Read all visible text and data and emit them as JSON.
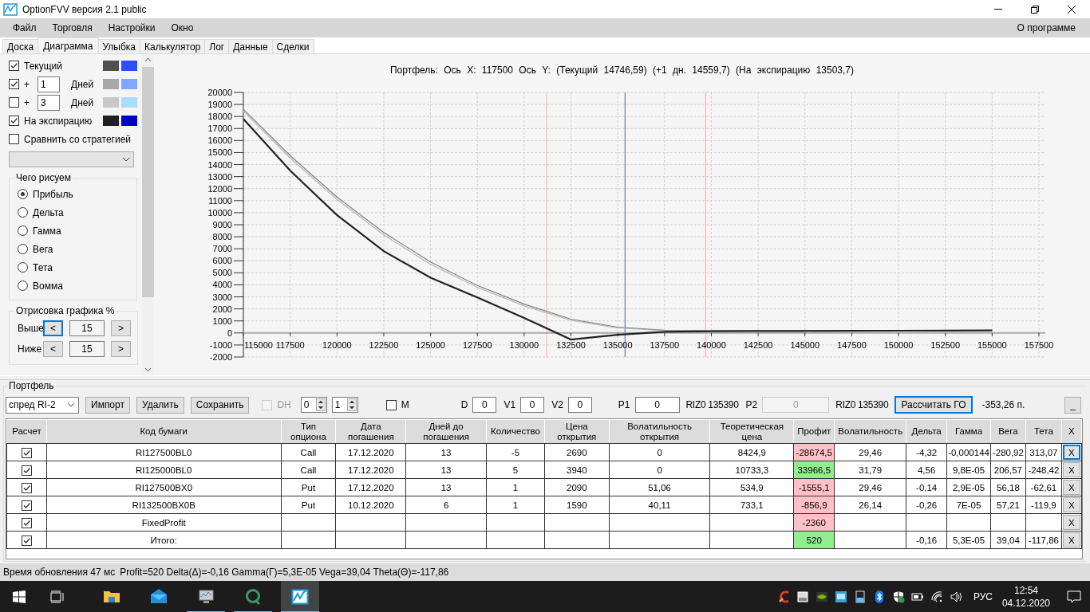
{
  "window": {
    "title": "OptionFVV версия 2.1 public"
  },
  "menu": {
    "items": [
      "Файл",
      "Торговля",
      "Настройки",
      "Окно"
    ],
    "right": "О программе"
  },
  "tabs": [
    {
      "label": "Доска",
      "selected": false
    },
    {
      "label": "Диаграмма",
      "selected": true
    },
    {
      "label": "Улыбка",
      "selected": false
    },
    {
      "label": "Калькулятор",
      "selected": false
    },
    {
      "label": "Лог",
      "selected": false
    },
    {
      "label": "Данные",
      "selected": false
    },
    {
      "label": "Сделки",
      "selected": false
    }
  ],
  "sidebar": {
    "curves": [
      {
        "kind": "plain",
        "checked": true,
        "label": "Текущий",
        "swatches": [
          {
            "color": "#505050"
          },
          {
            "color": "#2a4fff"
          }
        ]
      },
      {
        "kind": "days",
        "checked": true,
        "prefix": "+",
        "days": "1",
        "unit": "Дней",
        "swatches": [
          {
            "color": "#a8a8a8"
          },
          {
            "color": "#7fa8ff"
          }
        ]
      },
      {
        "kind": "days",
        "checked": false,
        "prefix": "+",
        "days": "3",
        "unit": "Дней",
        "swatches": [
          {
            "color": "#c8c8c8"
          },
          {
            "color": "#aadcff"
          }
        ]
      },
      {
        "kind": "plain",
        "checked": true,
        "label": "На экспирацию",
        "swatches": [
          {
            "color": "#202020"
          },
          {
            "color": "#0000c8"
          }
        ]
      }
    ],
    "compare": {
      "label": "Сравнить со стратегией",
      "checked": false
    },
    "plot_group": {
      "title": "Чего рисуем",
      "options": [
        {
          "label": "Прибыль",
          "selected": true
        },
        {
          "label": "Дельта",
          "selected": false
        },
        {
          "label": "Гамма",
          "selected": false
        },
        {
          "label": "Вега",
          "selected": false
        },
        {
          "label": "Тета",
          "selected": false
        },
        {
          "label": "Вомма",
          "selected": false
        }
      ]
    },
    "range_group": {
      "title": "Отрисовка графика %",
      "rows": [
        {
          "label": "Выше",
          "dec": "<",
          "value": "15",
          "inc": ">",
          "focused": true
        },
        {
          "label": "Ниже",
          "dec": "<",
          "value": "15",
          "inc": ">",
          "focused": false
        }
      ]
    }
  },
  "chart": {
    "chart_data": {
      "type": "line",
      "title": "Портфель: Ось X: 117500 Ось Y: (Текущий 14746,59) (+1 дн. 14559,7) (На экспирацию 13503,7)",
      "x": [
        115000,
        117500,
        120000,
        122500,
        125000,
        127500,
        130000,
        132500,
        135000,
        137500,
        140000,
        142500,
        145000,
        147500,
        150000,
        152500,
        155000
      ],
      "series": [
        {
          "color": "#808080",
          "values": [
            18600,
            14750,
            11300,
            8350,
            5900,
            3950,
            2400,
            1150,
            480,
            230,
            180,
            180,
            190,
            200,
            200,
            210,
            210
          ]
        },
        {
          "color": "#b4b4b4",
          "values": [
            18450,
            14550,
            11100,
            8150,
            5700,
            3800,
            2250,
            1050,
            420,
            200,
            170,
            170,
            180,
            190,
            200,
            200,
            210
          ]
        },
        {
          "color": "#222222",
          "values": [
            17800,
            13500,
            9800,
            6800,
            4600,
            2950,
            1250,
            -550,
            -150,
            100,
            150,
            160,
            170,
            180,
            190,
            200,
            210
          ]
        }
      ],
      "xlim": [
        115000,
        157500
      ],
      "ylim": [
        -2000,
        20000
      ],
      "xticks": [
        115000,
        117500,
        120000,
        122500,
        125000,
        127500,
        130000,
        132500,
        135000,
        137500,
        140000,
        142500,
        145000,
        147500,
        150000,
        152500,
        155000,
        157500
      ],
      "yticks": [
        -2000,
        -1000,
        0,
        1000,
        2000,
        3000,
        4000,
        5000,
        6000,
        7000,
        8000,
        9000,
        10000,
        11000,
        12000,
        13000,
        14000,
        15000,
        16000,
        17000,
        18000,
        19000,
        20000
      ],
      "grid": true,
      "ref_lines": [
        {
          "axis": "x",
          "value": 131200,
          "color": "#ffb0b8"
        },
        {
          "axis": "x",
          "value": 135390,
          "color": "#6a7fa8"
        },
        {
          "axis": "x",
          "value": 139700,
          "color": "#ffb0b8"
        }
      ]
    }
  },
  "portfolio": {
    "title": "Портфель",
    "strategy": "спред RI-2",
    "buttons": [
      "Импорт",
      "Удалить",
      "Сохранить"
    ],
    "dh": {
      "label": "DH",
      "checked": false,
      "disabled": true
    },
    "spinners": [
      "0",
      "1"
    ],
    "m": {
      "label": "M",
      "checked": false
    },
    "params": [
      {
        "kind": "field",
        "label": "D",
        "value": "0",
        "disabled": false
      },
      {
        "kind": "field",
        "label": "V1",
        "value": "0",
        "disabled": false
      },
      {
        "kind": "field",
        "label": "V2",
        "value": "0",
        "disabled": false
      },
      {
        "kind": "field",
        "label": "P1",
        "value": "0",
        "disabled": false
      },
      {
        "kind": "text",
        "text": "RIZ0 135390"
      },
      {
        "kind": "field",
        "label": "P2",
        "value": "0",
        "disabled": true
      },
      {
        "kind": "text",
        "text": "RIZ0 135390"
      }
    ],
    "calc_button": {
      "label": "Рассчитать ГО",
      "focused": true
    },
    "margin": "-353,26 п.",
    "collapse_button": "_",
    "table": {
      "columns": [
        "Расчет",
        "Код бумаги",
        "Тип опциона",
        "Дата погашения",
        "Дней до погашения",
        "Количество",
        "Цена открытия",
        "Волатильность открытия",
        "Теоретическая цена",
        "Профит",
        "Волатильность",
        "Дельта",
        "Гамма",
        "Вега",
        "Тета",
        "X"
      ],
      "rows": [
        {
          "checked": true,
          "code": "RI127500BL0",
          "type": "Call",
          "expiry": "17.12.2020",
          "days": "13",
          "qty": "-5",
          "open_price": "2690",
          "open_vol": "0",
          "theo": "8424,9",
          "profit": "-28674,5",
          "gain": false,
          "vol": "29,46",
          "delta": "-4,32",
          "gamma": "-0,000144",
          "vega": "-280,92",
          "theta": "313,07",
          "delete": "X",
          "focused": true
        },
        {
          "checked": true,
          "code": "RI125000BL0",
          "type": "Call",
          "expiry": "17.12.2020",
          "days": "13",
          "qty": "5",
          "open_price": "3940",
          "open_vol": "0",
          "theo": "10733,3",
          "profit": "33966,5",
          "gain": true,
          "vol": "31,79",
          "delta": "4,56",
          "gamma": "9,8E-05",
          "vega": "206,57",
          "theta": "-248,42",
          "delete": "X",
          "focused": false
        },
        {
          "checked": true,
          "code": "RI127500BX0",
          "type": "Put",
          "expiry": "17.12.2020",
          "days": "13",
          "qty": "1",
          "open_price": "2090",
          "open_vol": "51,06",
          "theo": "534,9",
          "profit": "-1555,1",
          "gain": false,
          "vol": "29,46",
          "delta": "-0,14",
          "gamma": "2,9E-05",
          "vega": "56,18",
          "theta": "-62,61",
          "delete": "X",
          "focused": false
        },
        {
          "checked": true,
          "code": "RI132500BX0B",
          "type": "Put",
          "expiry": "10.12.2020",
          "days": "6",
          "qty": "1",
          "open_price": "1590",
          "open_vol": "40,11",
          "theo": "733,1",
          "profit": "-856,9",
          "gain": false,
          "vol": "26,14",
          "delta": "-0,26",
          "gamma": "7E-05",
          "vega": "57,21",
          "theta": "-119,9",
          "delete": "X",
          "focused": false
        },
        {
          "checked": true,
          "code": "FixedProfit",
          "profit": "-2360",
          "gain": false,
          "delete": "X",
          "focused": false
        },
        {
          "checked": true,
          "code": "Итого:",
          "profit": "520",
          "gain": true,
          "delta": "-0,16",
          "gamma": "5,3E-05",
          "vega": "39,04",
          "theta": "-117,86",
          "delete": "X",
          "focused": false
        }
      ]
    }
  },
  "status_bar": {
    "update_time": "Время обновления 47 мс",
    "summary": "Profit=520 Delta(Δ)=-0,16 Gamma(Γ)=5,3E-05 Vega=39,04 Theta(Θ)=-117,86"
  },
  "taskbar": {
    "apps": [
      {
        "kind": "folder",
        "running": false,
        "selected": false
      },
      {
        "kind": "mail",
        "running": false,
        "selected": false
      },
      {
        "kind": "monitor",
        "running": true,
        "selected": false
      },
      {
        "kind": "q",
        "running": true,
        "selected": false
      },
      {
        "kind": "chart",
        "running": true,
        "selected": true
      }
    ],
    "language": "РУС",
    "time": "12:54",
    "date": "04.12.2020"
  }
}
